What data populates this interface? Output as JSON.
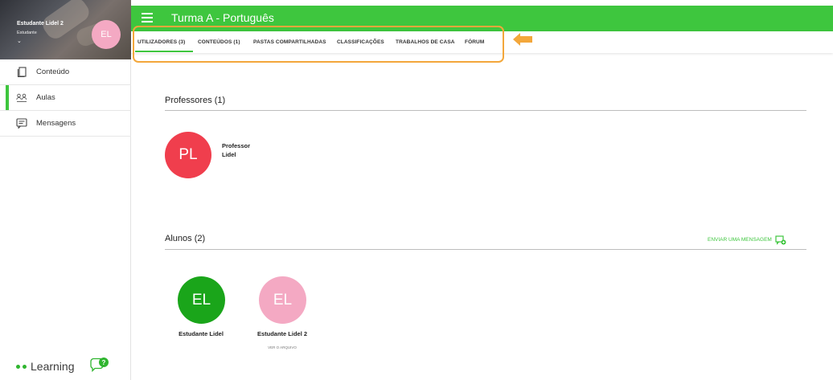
{
  "sidebar": {
    "profile": {
      "name": "Estudante Lidel 2",
      "role": "Estudante",
      "initials": "EL",
      "chevron": "⌄",
      "avatar_color": "#f4a9c3"
    },
    "items": [
      {
        "label": "Conteúdo",
        "icon": "document-icon"
      },
      {
        "label": "Aulas",
        "icon": "people-icon",
        "active": true
      },
      {
        "label": "Mensagens",
        "icon": "message-icon"
      }
    ],
    "brand": "Learning",
    "help_icon": "help-chat-icon",
    "help_badge": "?"
  },
  "header": {
    "title": "Turma A - Português",
    "menu_icon": "hamburger-icon",
    "accent": "#3ec63e"
  },
  "tabs": [
    {
      "label": "UTILIZADORES (3)",
      "active": true
    },
    {
      "label": "CONTEÚDOS (1)"
    },
    {
      "label": "PASTAS COMPARTILHADAS"
    },
    {
      "label": "CLASSIFICAÇÕES"
    },
    {
      "label": "TRABALHOS DE CASA"
    },
    {
      "label": "FÓRUM"
    }
  ],
  "annotation": {
    "color": "#f3a73b",
    "arrow_icon": "arrow-left-icon"
  },
  "main": {
    "teachers": {
      "title": "Professores (1)",
      "people": [
        {
          "initials": "PL",
          "name_line1": "Professor",
          "name_line2": "Lidel",
          "color": "#f03e4d"
        }
      ]
    },
    "students": {
      "title": "Alunos (2)",
      "send_message": "ENVIAR UMA MENSAGEM",
      "people": [
        {
          "initials": "EL",
          "name": "Estudante Lidel",
          "color": "#1aa51a"
        },
        {
          "initials": "EL",
          "name": "Estudante Lidel 2",
          "color": "#f4a9c3",
          "link": "VER O ARQUIVO"
        }
      ]
    }
  }
}
